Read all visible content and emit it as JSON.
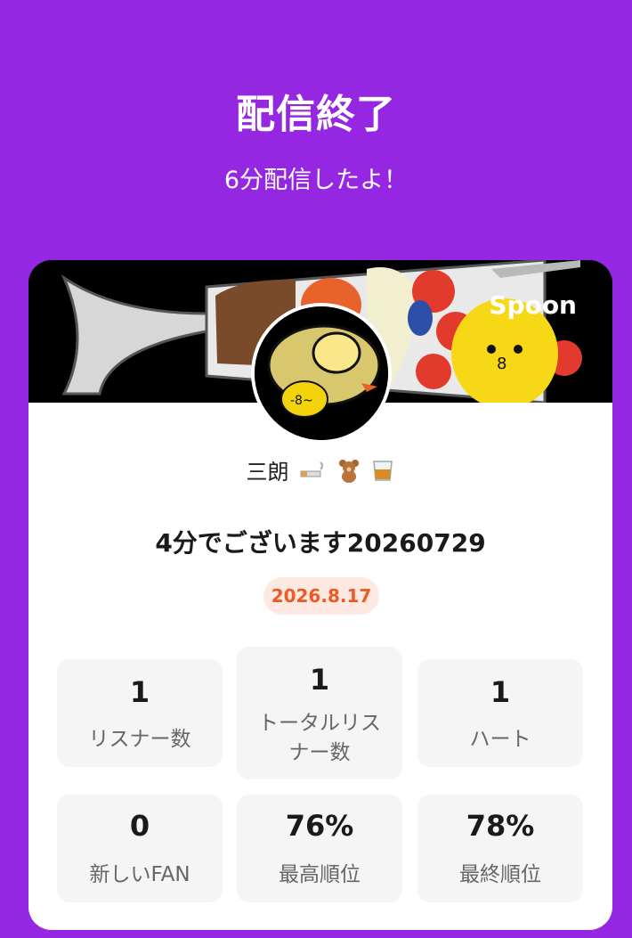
{
  "header": {
    "title": "配信終了",
    "subtitle": "6分配信したよ！"
  },
  "card": {
    "brand": "Spoon",
    "username": "三朗",
    "username_emoji": [
      "cigarette-icon",
      "teddy-bear-icon",
      "whisky-glass-icon"
    ],
    "live_title": "4分でございます20260729",
    "date": "2026.8.17"
  },
  "stats": [
    {
      "value": "1",
      "label": "リスナー数"
    },
    {
      "value": "1",
      "label": "トータルリスナー数"
    },
    {
      "value": "1",
      "label": "ハート"
    },
    {
      "value": "0",
      "label": "新しいFAN"
    },
    {
      "value": "76%",
      "label": "最高順位"
    },
    {
      "value": "78%",
      "label": "最終順位"
    }
  ],
  "colors": {
    "background": "#9526e2",
    "date_accent": "#ee5a24",
    "date_badge_bg": "#fde9e1",
    "stat_bg": "#f5f5f5"
  }
}
